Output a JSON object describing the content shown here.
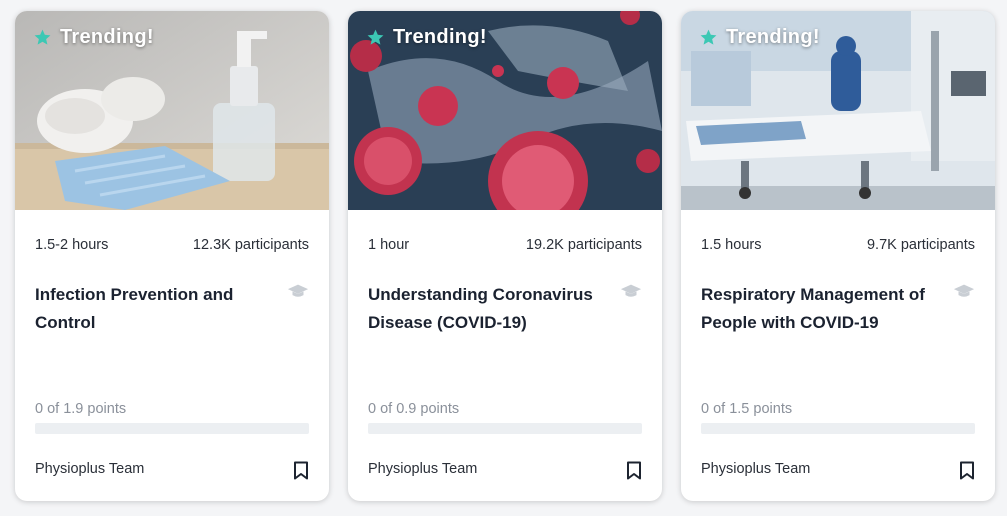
{
  "colors": {
    "accent": "#3cc8b4",
    "cap_icon": "#c9ced4",
    "card_bg": "#ffffff"
  },
  "cards": [
    {
      "badge": "Trending!",
      "badge_icon": "star-icon",
      "image": "masks-and-sanitizer-photo",
      "duration": "1.5-2 hours",
      "participants": "12.3K participants",
      "title": "Infection Prevention and Control",
      "points": "0 of 1.9 points",
      "progress": 0,
      "author": "Physioplus Team",
      "bookmark_icon": "bookmark-icon",
      "cap_icon": "graduation-cap-icon"
    },
    {
      "badge": "Trending!",
      "badge_icon": "star-icon",
      "image": "coronavirus-over-map-photo",
      "duration": "1 hour",
      "participants": "19.2K participants",
      "title": "Understanding Coronavirus Disease (COVID-19)",
      "points": "0 of 0.9 points",
      "progress": 0,
      "author": "Physioplus Team",
      "bookmark_icon": "bookmark-icon",
      "cap_icon": "graduation-cap-icon"
    },
    {
      "badge": "Trending!",
      "badge_icon": "star-icon",
      "image": "hospital-icu-photo",
      "duration": "1.5 hours",
      "participants": "9.7K participants",
      "title": "Respiratory Management of People with COVID-19",
      "points": "0 of 1.5 points",
      "progress": 0,
      "author": "Physioplus Team",
      "bookmark_icon": "bookmark-icon",
      "cap_icon": "graduation-cap-icon"
    }
  ]
}
